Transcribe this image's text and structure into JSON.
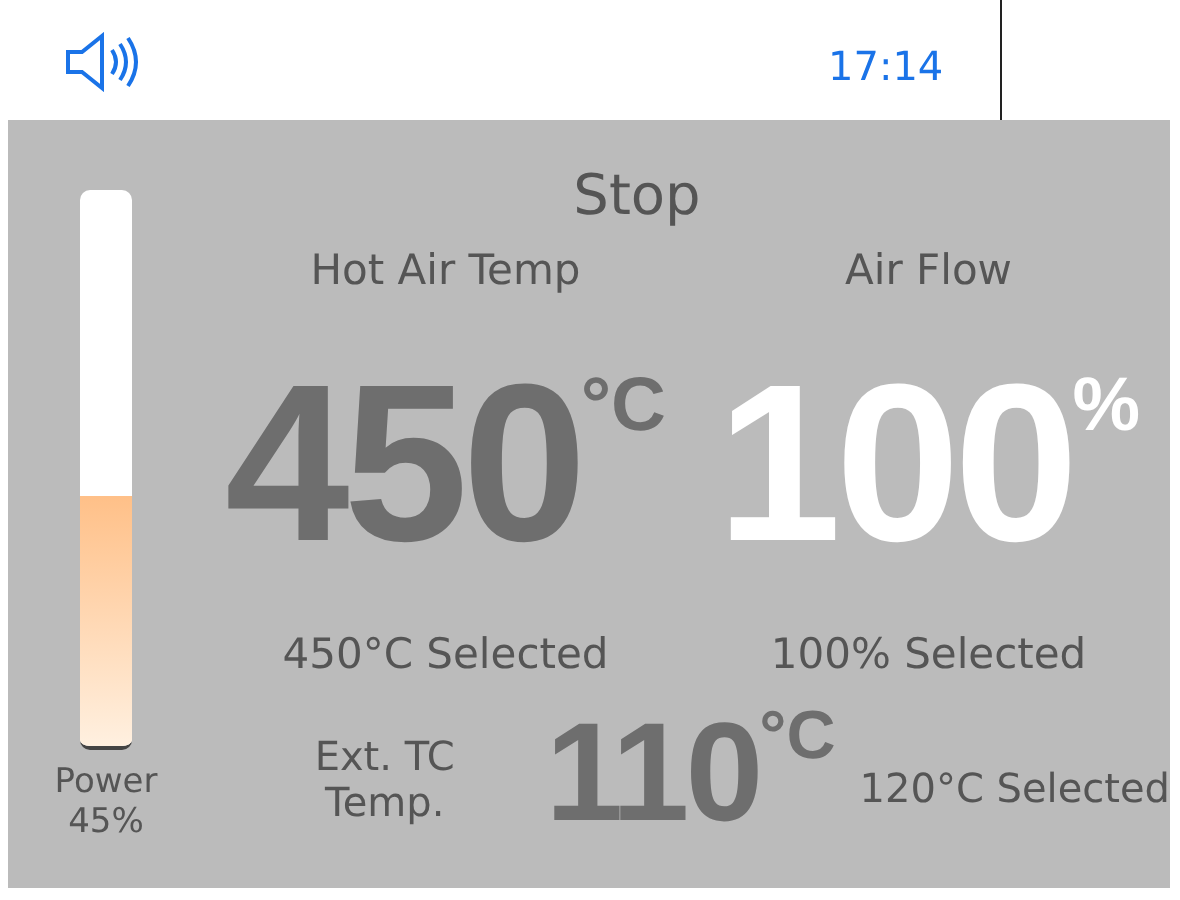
{
  "status_bar": {
    "time": "17:14"
  },
  "power": {
    "label": "Power",
    "reading": "45%",
    "level": 0.45
  },
  "state": "Stop",
  "readings": [
    {
      "label": "Hot Air Temp",
      "value": "450",
      "unit": "°C",
      "selected_text": "450°C Selected",
      "selected": false
    },
    {
      "label": "Air Flow",
      "value": "100",
      "unit": "%",
      "selected_text": "100% Selected",
      "selected": true
    }
  ],
  "external": {
    "label": "Ext. TC Temp.",
    "value": "110",
    "unit": "°C",
    "selected_text": "120°C Selected"
  }
}
